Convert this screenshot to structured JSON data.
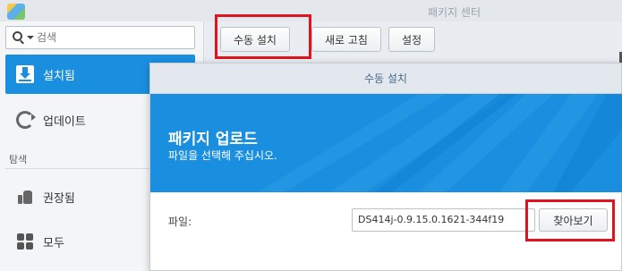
{
  "window": {
    "title": "패키지 센터"
  },
  "search": {
    "placeholder": "검색"
  },
  "sidebar": {
    "items": [
      {
        "label": "설치됨",
        "icon": "download-icon",
        "active": true
      },
      {
        "label": "업데이트",
        "icon": "refresh-icon"
      }
    ],
    "section": "탐색",
    "explore_items": [
      {
        "label": "권장됨",
        "icon": "thumbs-up-icon"
      },
      {
        "label": "모두",
        "icon": "grid-icon"
      }
    ]
  },
  "toolbar": {
    "manual_install": "수동 설치",
    "refresh": "새로 고침",
    "settings": "설정"
  },
  "dialog": {
    "title": "수동 설치",
    "banner_title": "패키지 업로드",
    "banner_subtitle": "파일을 선택해 주십시오.",
    "file_label": "파일:",
    "file_value": "DS414j-0.9.15.0.1621-344f19",
    "browse": "찾아보기"
  },
  "colors": {
    "accent": "#1a8fe0",
    "highlight": "#e0141e"
  }
}
